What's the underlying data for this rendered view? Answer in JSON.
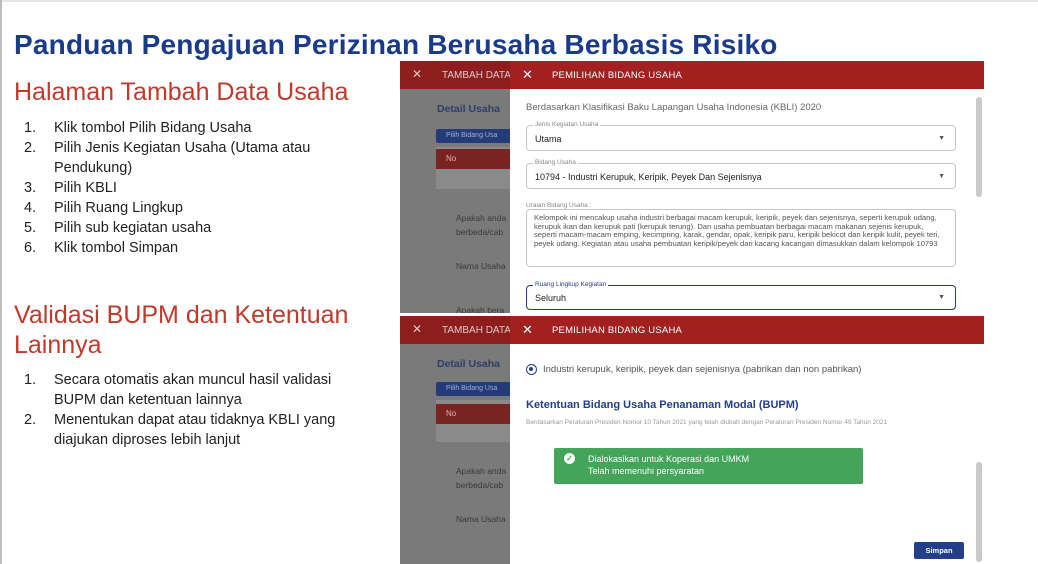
{
  "main_title": "Panduan Pengajuan Perizinan Berusaha Berbasis Risiko",
  "section1": {
    "title": "Halaman Tambah Data Usaha",
    "steps": [
      {
        "num": "1.",
        "text": "Klik tombol Pilih Bidang Usaha"
      },
      {
        "num": "2.",
        "text": "Pilih Jenis Kegiatan Usaha (Utama atau Pendukung)"
      },
      {
        "num": "3.",
        "text": "Pilih KBLI"
      },
      {
        "num": "4.",
        "text": "Pilih Ruang Lingkup"
      },
      {
        "num": "5.",
        "text": "Pilih sub kegiatan usaha"
      },
      {
        "num": "6.",
        "text": "Klik tombol Simpan"
      }
    ]
  },
  "section2": {
    "title": "Validasi BUPM dan Ketentuan Lainnya",
    "steps": [
      {
        "num": "1.",
        "text": "Secara otomatis akan muncul hasil validasi BUPM dan ketentuan lainnya"
      },
      {
        "num": "2.",
        "text": "Menentukan dapat atau tidaknya KBLI yang diajukan diproses lebih lanjut"
      }
    ]
  },
  "screenshot1": {
    "bg_header": "TAMBAH DATA",
    "bg_detail": "Detail Usaha",
    "bg_button": "Pilih Bidang Usa",
    "bg_col_no": "No",
    "bg_q_line1": "Apakah anda",
    "bg_q_line2": "berbeda/cab",
    "bg_nama": "Nama Usaha",
    "bg_apakah": "Apakah bera",
    "modal_title": "PEMILIHAN BIDANG USAHA",
    "kbli_note": "Berdasarkan Klasifikasi Baku Lapangan Usaha Indonesia (KBLI) 2020",
    "jenis_label": "Jenis Kegiatan Usaha",
    "jenis_value": "Utama",
    "bidang_label": "Bidang Usaha",
    "bidang_value": "10794 - Industri Kerupuk, Keripik, Peyek Dan Sejenisnya",
    "uraian_label": "Uraian Bidang Usaha :",
    "uraian_text": "Kelompok ini mencakup usaha industri berbagai macam kerupuk, keripik, peyek dan sejenisnya, seperti kerupuk udang, kerupuk ikan dan kerupuk pati (kerupuk terung). Dan usaha pembuatan berbagai macam makanan sejenis kerupuk, seperti macam-macam emping, kecimpring, karak, gendar, opak, keripik paru, keripik bekicot dan keripik kulit, peyek teri, peyek udang. Kegiatan atau usaha pembuatan keripik/peyek dari kacang kacangan dimasukkan dalam kelompok 10793",
    "ruang_label": "Ruang Lingkup Kegiatan",
    "ruang_value": "Seluruh"
  },
  "screenshot2": {
    "bg_header": "TAMBAH DATA",
    "bg_detail": "Detail Usaha",
    "bg_button": "Pilih Bidang Usa",
    "bg_col_no": "No",
    "bg_q_line1": "Apakah anda",
    "bg_q_line2": "berbeda/cab",
    "bg_nama": "Nama Usaha",
    "modal_title": "PEMILIHAN BIDANG USAHA",
    "radio_label": "Industri kerupuk, keripik, peyek dan sejenisnya (pabrikan dan non pabrikan)",
    "bupm_title": "Ketentuan Bidang Usaha Penanaman Modal (BUPM)",
    "bupm_sub": "Berdasarkan Peraturan Presiden Nomor 10 Tahun 2021 yang telah diubah dengan Peraturan Presiden Nomor 49 Tahun 2021",
    "alert_line1": "Dialokasikan untuk Koperasi dan UMKM",
    "alert_line2": "Telah memenuhi persyaratan",
    "save_label": "Simpan"
  },
  "colors": {
    "title_blue": "#1a3a8c",
    "section_red": "#c0392b",
    "modal_header": "#a32020",
    "primary": "#233e8a",
    "success": "#43a55a"
  }
}
